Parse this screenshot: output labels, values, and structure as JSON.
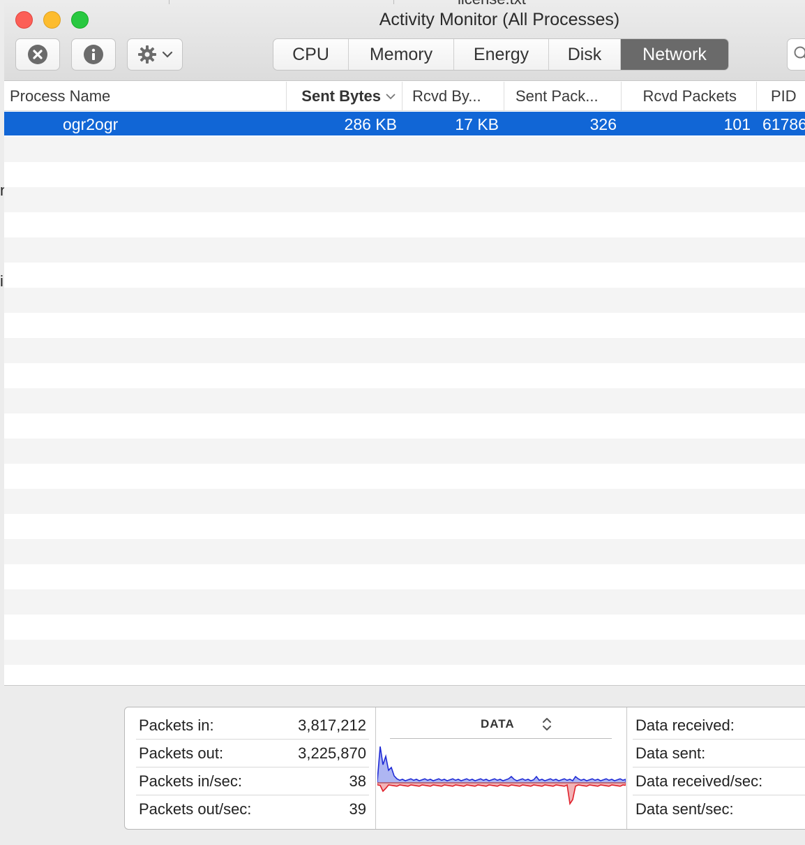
{
  "desktop": {
    "behind_window_text": "license.txt",
    "edge_chars": [
      "n",
      "i"
    ]
  },
  "window": {
    "title": "Activity Monitor (All Processes)"
  },
  "toolbar": {
    "stop_icon": "x-circle-icon",
    "info_icon": "info-icon",
    "action_icon": "gear-icon",
    "tabs": [
      {
        "label": "CPU",
        "active": false
      },
      {
        "label": "Memory",
        "active": false
      },
      {
        "label": "Energy",
        "active": false
      },
      {
        "label": "Disk",
        "active": false
      },
      {
        "label": "Network",
        "active": true
      }
    ]
  },
  "table": {
    "columns": [
      "Process Name",
      "Sent Bytes",
      "Rcvd By...",
      "Sent Pack...",
      "Rcvd Packets",
      "PID"
    ],
    "sorted_column": "Sent Bytes",
    "rows": [
      {
        "name": "ogr2ogr",
        "sent_bytes": "286 KB",
        "rcvd_bytes": "17 KB",
        "sent_packets": "326",
        "rcvd_packets": "101",
        "pid": "61786"
      }
    ]
  },
  "stats": {
    "left": [
      {
        "label": "Packets in:",
        "value": "3,817,212"
      },
      {
        "label": "Packets out:",
        "value": "3,225,870"
      },
      {
        "label": "Packets in/sec:",
        "value": "38"
      },
      {
        "label": "Packets out/sec:",
        "value": "39"
      }
    ],
    "graph_title": "DATA",
    "right": [
      {
        "label": "Data received:"
      },
      {
        "label": "Data sent:"
      },
      {
        "label": "Data received/sec:"
      },
      {
        "label": "Data sent/sec:"
      }
    ],
    "colors": {
      "received": "#1f2bd6",
      "sent": "#e0202a",
      "received_fill": "#aeb6f2",
      "sent_fill": "#f2b3b6"
    }
  }
}
